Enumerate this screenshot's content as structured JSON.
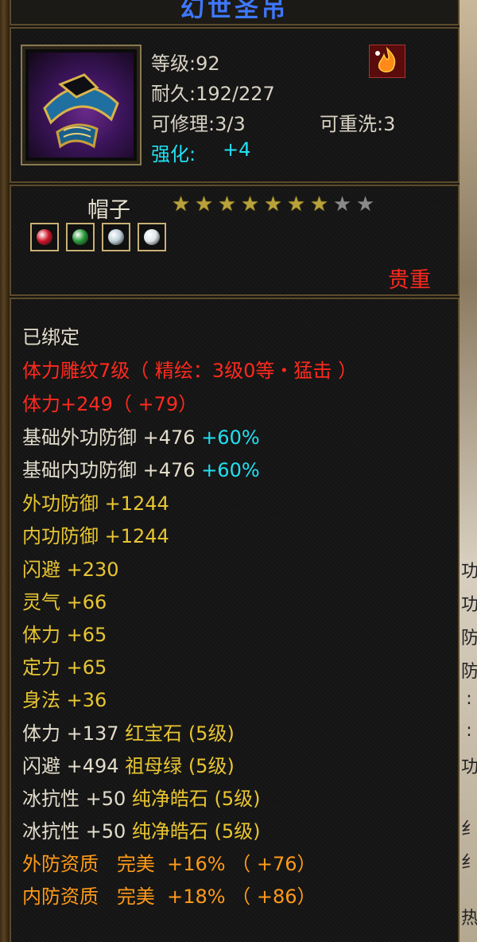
{
  "title": "幻世圣吊",
  "item": {
    "level": "等级:92",
    "durability": "耐久:192/227",
    "repairable": "可修理:3/3",
    "rewash": "可重洗:3",
    "enhance_label": "强化:",
    "enhance_value": "+4",
    "name": "帽子",
    "stars_lit": 7,
    "stars_total": 9,
    "quality": "贵重"
  },
  "gems": [
    {
      "icon": "ruby-gem-icon",
      "color": "#d0162a"
    },
    {
      "icon": "emerald-gem-icon",
      "color": "#2a9a3a"
    },
    {
      "icon": "diamond-gem-icon",
      "color": "#bfd0d8"
    },
    {
      "icon": "diamond-gem-icon",
      "color": "#dfe6ea"
    }
  ],
  "colors": {
    "title": "#3f78ff",
    "quality": "#ff2a1e",
    "cyan": "#21e0f2",
    "yellow": "#e8c532",
    "orange": "#ff9a18",
    "red": "#ff2a1e"
  },
  "attributes": {
    "bound": "已绑定",
    "engrave": "体力雕纹7级（ 精绘：3级0等・猛击 ）",
    "stamina_total": "体力+249（ +79）",
    "base_ext_def": "基础外功防御 +476",
    "base_ext_def_pct": "+60%",
    "base_int_def": "基础内功防御 +476",
    "base_int_def_pct": "+60%",
    "ext_def": "外功防御 +1244",
    "int_def": "内功防御 +1244",
    "dodge": "闪避 +230",
    "spirit": "灵气 +66",
    "stamina": "体力 +65",
    "focus": "定力 +65",
    "agility": "身法 +36",
    "gem1_stat": "体力 +137",
    "gem1_name": "红宝石 (5级)",
    "gem2_stat": "闪避 +494",
    "gem2_name": "祖母绿 (5级)",
    "gem3_stat": "冰抗性 +50",
    "gem3_name": "纯净皓石 (5级)",
    "gem4_stat": "冰抗性 +50",
    "gem4_name": "纯净皓石 (5级)",
    "ext_aptitude": "外防资质",
    "ext_aptitude_grade": "完美",
    "ext_aptitude_val": "+16% （ +76）",
    "int_aptitude": "内防资质",
    "int_aptitude_grade": "完美",
    "int_aptitude_val": "+18% （ +86）"
  },
  "right_edge_fragments": [
    "功",
    "功",
    "防",
    "防",
    ":",
    ":",
    "功",
    "纟",
    "纟",
    "热"
  ]
}
